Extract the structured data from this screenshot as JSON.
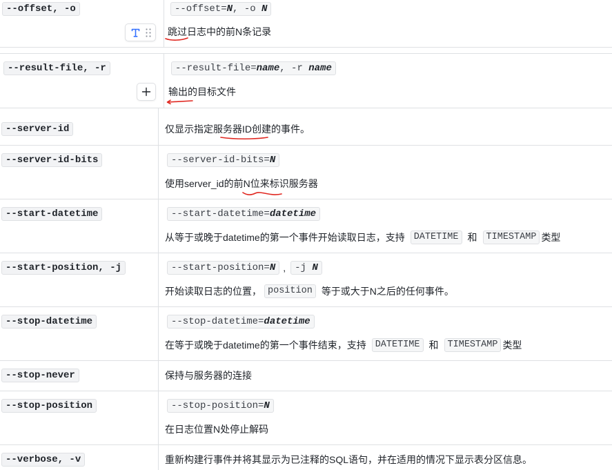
{
  "rows": [
    {
      "option": "--offset, -o",
      "syntax": [
        [
          "--offset=",
          "N",
          ", -o ",
          "N"
        ]
      ],
      "desc": "跳过日志中的前N条记录"
    },
    {
      "option": "--result-file, -r",
      "syntax": [
        [
          "--result-file=",
          "name",
          ", -r ",
          "name"
        ]
      ],
      "desc": "输出的目标文件"
    },
    {
      "option": "--server-id",
      "desc": "仅显示指定服务器ID创建的事件。"
    },
    {
      "option": "--server-id-bits",
      "syntax": [
        [
          "--server-id-bits=",
          "N"
        ]
      ],
      "desc": "使用server_id的前N位来标识服务器"
    },
    {
      "option": "--start-datetime",
      "syntax": [
        [
          "--start-datetime=",
          "datetime"
        ]
      ],
      "desc": [
        "从等于或晚于datetime的第一个事件开始读取日志，支持",
        "DATETIME",
        "和",
        "TIMESTAMP",
        "类型"
      ]
    },
    {
      "option": "--start-position, -j",
      "syntax": [
        [
          "--start-position=",
          "N"
        ],
        [
          "-j ",
          "N"
        ]
      ],
      "syntax_separator": ",",
      "desc": [
        "开始读取日志的位置，",
        "position",
        "等于或大于N之后的任何事件。"
      ]
    },
    {
      "option": "--stop-datetime",
      "syntax": [
        [
          "--stop-datetime=",
          "datetime"
        ]
      ],
      "desc": [
        "在等于或晚于datetime的第一个事件结束，支持",
        "DATETIME",
        "和",
        "TIMESTAMP",
        "类型"
      ]
    },
    {
      "option": "--stop-never",
      "desc": "保持与服务器的连接"
    },
    {
      "option": "--stop-position",
      "syntax": [
        [
          "--stop-position=",
          "N"
        ]
      ],
      "desc": "在日志位置N处停止解码"
    },
    {
      "option": "--verbose, -v",
      "desc": "重新构建行事件并将其显示为已注释的SQL语句，并在适用的情况下显示表分区信息。"
    }
  ],
  "block_toolbar": {
    "icons": [
      "text-style-icon",
      "drag-handle-icon"
    ]
  },
  "add_block_button": {
    "icon": "plus-icon"
  },
  "colors": {
    "text": "#1f2329",
    "border": "#dee0e3",
    "code_bg": "#f5f6f7",
    "accent": "#3370ff",
    "annotation": "#e0261f"
  }
}
